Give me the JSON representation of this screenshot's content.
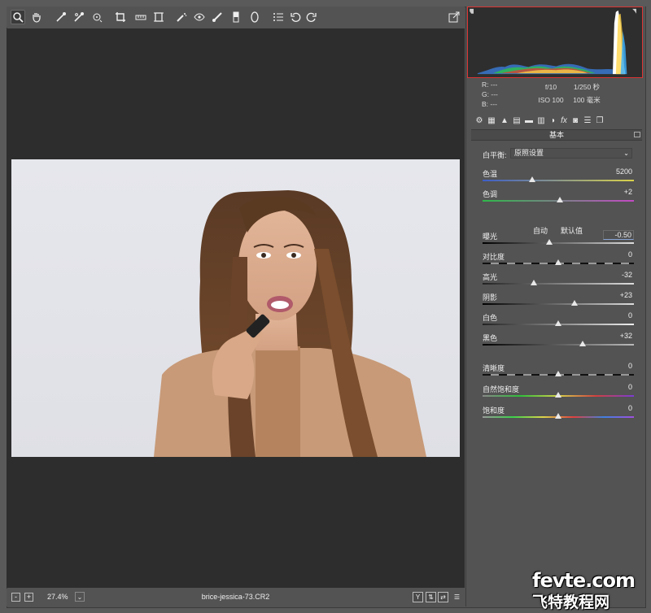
{
  "toolbar": {
    "tools": [
      "zoom-icon",
      "hand-icon",
      "white-balance-icon",
      "color-sampler-icon",
      "target-adjust-icon",
      "crop-icon",
      "straighten-icon",
      "transform-icon",
      "spot-removal-icon",
      "red-eye-icon",
      "adjustment-brush-icon",
      "graduated-filter-icon",
      "radial-filter-icon",
      "presets-icon",
      "rotate-left-icon",
      "rotate-right-icon"
    ],
    "export_icon": "export-icon"
  },
  "bottom": {
    "zoom_minus": "-",
    "zoom_plus": "+",
    "zoom_level": "27.4%",
    "zoom_dropdown": "⌄",
    "filename": "brice-jessica-73.CR2",
    "view_y": "Y",
    "view_toggle": "⇅",
    "view_swap": "⇄",
    "settings": "☰"
  },
  "info": {
    "r_label": "R:",
    "r_value": "---",
    "g_label": "G:",
    "g_value": "---",
    "b_label": "B:",
    "b_value": "---",
    "aperture": "f/10",
    "shutter": "1/250 秒",
    "iso": "ISO 100",
    "focal": "100 毫米"
  },
  "panel": {
    "section_title": "基本",
    "wb_label": "白平衡:",
    "wb_value": "原照设置",
    "auto_label": "自动",
    "default_label": "默认值",
    "sliders": [
      {
        "label": "色温",
        "value": "5200",
        "pos": 0.33
      },
      {
        "label": "色调",
        "value": "+2",
        "pos": 0.51
      },
      {
        "label": "曝光",
        "value": "-0.50",
        "pos": 0.44
      },
      {
        "label": "对比度",
        "value": "0",
        "pos": 0.5
      },
      {
        "label": "高光",
        "value": "-32",
        "pos": 0.34
      },
      {
        "label": "阴影",
        "value": "+23",
        "pos": 0.61
      },
      {
        "label": "白色",
        "value": "0",
        "pos": 0.5
      },
      {
        "label": "黑色",
        "value": "+32",
        "pos": 0.66
      },
      {
        "label": "清晰度",
        "value": "0",
        "pos": 0.5
      },
      {
        "label": "自然饱和度",
        "value": "0",
        "pos": 0.5
      },
      {
        "label": "饱和度",
        "value": "0",
        "pos": 0.5
      }
    ]
  },
  "watermark": {
    "line1": "fevte.com",
    "line2": "飞特教程网"
  }
}
